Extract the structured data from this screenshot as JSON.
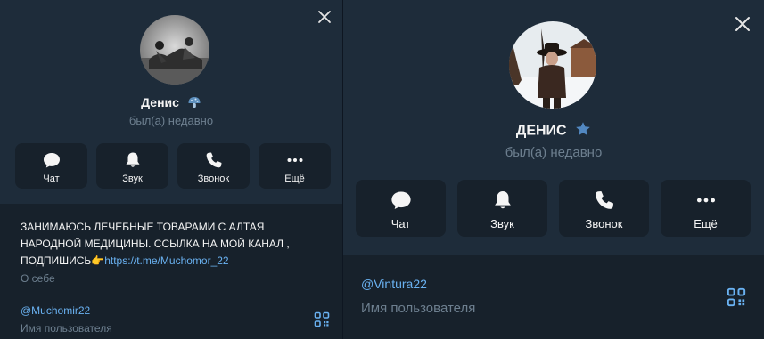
{
  "colors": {
    "background": "#17212b",
    "header_background": "#1e2c3a",
    "accent": "#6ab2f2",
    "muted_text": "#6d7f8f",
    "primary_text": "#f5f5f5",
    "star_badge": "#5288c1"
  },
  "left_panel": {
    "name": "Денис",
    "name_badge_icon": "mushroom-icon",
    "status": "был(а) недавно",
    "actions": [
      {
        "label": "Чат",
        "icon": "chat-icon"
      },
      {
        "label": "Звук",
        "icon": "bell-icon"
      },
      {
        "label": "Звонок",
        "icon": "phone-icon"
      },
      {
        "label": "Ещё",
        "icon": "more-icon"
      }
    ],
    "bio": {
      "line1": "ЗАНИМАЮСЬ ЛЕЧЕБНЫЕ ТОВАРАМИ С АЛТАЯ",
      "line2": "НАРОДНОЙ МЕДИЦИНЫ. ССЫЛКА НА МОЙ КАНАЛ ,",
      "line3_text": "ПОДПИШИСЬ",
      "line3_emoji": "👉",
      "link": "https://t.me/Muchomor_22"
    },
    "bio_label": "О себе",
    "username": "@Muchomir22",
    "username_label": "Имя пользователя"
  },
  "right_panel": {
    "name": "ДЕНИС",
    "name_badge_icon": "star-icon",
    "status": "был(а) недавно",
    "actions": [
      {
        "label": "Чат",
        "icon": "chat-icon"
      },
      {
        "label": "Звук",
        "icon": "bell-icon"
      },
      {
        "label": "Звонок",
        "icon": "phone-icon"
      },
      {
        "label": "Ещё",
        "icon": "more-icon"
      }
    ],
    "username": "@Vintura22",
    "username_label": "Имя пользователя"
  }
}
